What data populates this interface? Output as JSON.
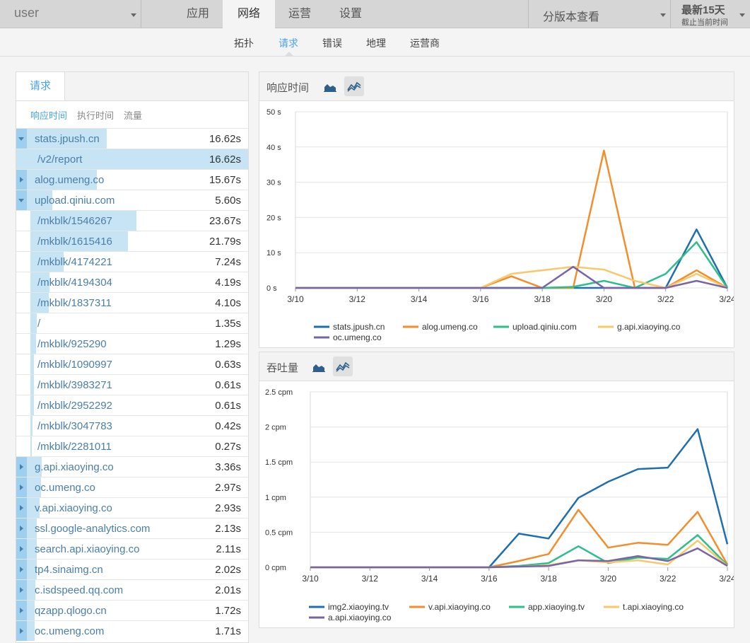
{
  "topnav": {
    "user": "user",
    "tabs": [
      "应用",
      "网络",
      "运营",
      "设置"
    ],
    "active_tab": 1,
    "version_select": "分版本查看",
    "range_title": "最新15天",
    "range_sub": "截止当前时间"
  },
  "subnav": {
    "tabs": [
      "拓扑",
      "请求",
      "错误",
      "地理",
      "运营商"
    ],
    "active": 1
  },
  "left": {
    "tab": "请求",
    "metrics": [
      "响应时间",
      "执行时间",
      "流量"
    ],
    "rows": [
      {
        "name": "stats.jpush.cn",
        "value": "16.62s",
        "kind": "down",
        "ratio": 0.75
      },
      {
        "name": "/v2/report",
        "value": "16.62s",
        "kind": "child",
        "ratio": 0.75,
        "selected": true
      },
      {
        "name": "alog.umeng.co",
        "value": "15.67s",
        "kind": "right",
        "ratio": 0.66
      },
      {
        "name": "upload.qiniu.com",
        "value": "5.60s",
        "kind": "down",
        "ratio": 0.24
      },
      {
        "name": "/mkblk/1546267",
        "value": "23.67s",
        "kind": "child",
        "ratio": 1.0
      },
      {
        "name": "/mkblk/1615416",
        "value": "21.79s",
        "kind": "child",
        "ratio": 0.92
      },
      {
        "name": "/mkblk/4174221",
        "value": "7.24s",
        "kind": "child",
        "ratio": 0.31
      },
      {
        "name": "/mkblk/4194304",
        "value": "4.19s",
        "kind": "child",
        "ratio": 0.18
      },
      {
        "name": "/mkblk/1837311",
        "value": "4.10s",
        "kind": "child",
        "ratio": 0.17
      },
      {
        "name": "/",
        "value": "1.35s",
        "kind": "child",
        "ratio": 0.06
      },
      {
        "name": "/mkblk/925290",
        "value": "1.29s",
        "kind": "child",
        "ratio": 0.05
      },
      {
        "name": "/mkblk/1090997",
        "value": "0.63s",
        "kind": "child",
        "ratio": 0.03
      },
      {
        "name": "/mkblk/3983271",
        "value": "0.61s",
        "kind": "child",
        "ratio": 0.03
      },
      {
        "name": "/mkblk/2952292",
        "value": "0.61s",
        "kind": "child",
        "ratio": 0.03
      },
      {
        "name": "/mkblk/3047783",
        "value": "0.42s",
        "kind": "child",
        "ratio": 0.02
      },
      {
        "name": "/mkblk/2281011",
        "value": "0.27s",
        "kind": "child",
        "ratio": 0.01
      },
      {
        "name": "g.api.xiaoying.co",
        "value": "3.36s",
        "kind": "right",
        "ratio": 0.14
      },
      {
        "name": "oc.umeng.co",
        "value": "2.97s",
        "kind": "right",
        "ratio": 0.13
      },
      {
        "name": "v.api.xiaoying.co",
        "value": "2.93s",
        "kind": "right",
        "ratio": 0.12
      },
      {
        "name": "ssl.google-analytics.com",
        "value": "2.13s",
        "kind": "right",
        "ratio": 0.09
      },
      {
        "name": "search.api.xiaoying.co",
        "value": "2.11s",
        "kind": "right",
        "ratio": 0.09
      },
      {
        "name": "tp4.sinaimg.cn",
        "value": "2.02s",
        "kind": "right",
        "ratio": 0.09
      },
      {
        "name": "c.isdspeed.qq.com",
        "value": "2.01s",
        "kind": "right",
        "ratio": 0.08
      },
      {
        "name": "qzapp.qlogo.cn",
        "value": "1.72s",
        "kind": "right",
        "ratio": 0.07
      },
      {
        "name": "oc.umeng.com",
        "value": "1.71s",
        "kind": "right",
        "ratio": 0.07
      }
    ]
  },
  "charts": {
    "response": {
      "title": "响应时间"
    },
    "throughput": {
      "title": "吞吐量"
    }
  },
  "chart_data": [
    {
      "type": "line",
      "title": "响应时间",
      "x": [
        "3/10",
        "3/11",
        "3/12",
        "3/13",
        "3/14",
        "3/15",
        "3/16",
        "3/17",
        "3/18",
        "3/19",
        "3/20",
        "3/21",
        "3/22",
        "3/23",
        "3/24"
      ],
      "x_ticks": [
        "3/10",
        "3/12",
        "3/14",
        "3/16",
        "3/18",
        "3/20",
        "3/22",
        "3/24"
      ],
      "y_ticks": [
        "0 s",
        "10 s",
        "20 s",
        "30 s",
        "40 s",
        "50 s"
      ],
      "ylim": [
        0,
        50
      ],
      "grid": true,
      "legend": "bottom",
      "series": [
        {
          "name": "stats.jpush.cn",
          "color": "#1f6fad",
          "values": [
            0,
            0,
            0,
            0,
            0,
            0,
            0,
            0,
            0,
            0,
            0,
            0,
            0,
            16.6,
            0
          ]
        },
        {
          "name": "alog.umeng.co",
          "color": "#f28e2b",
          "values": [
            0,
            0,
            0,
            0,
            0,
            0,
            0,
            3.3,
            0,
            0,
            39,
            0,
            0,
            5,
            0
          ]
        },
        {
          "name": "upload.qiniu.com",
          "color": "#2bbf8a",
          "values": [
            0,
            0,
            0,
            0,
            0,
            0,
            0,
            0,
            0,
            0.3,
            2,
            0,
            4,
            13,
            0
          ]
        },
        {
          "name": "g.api.xiaoying.co",
          "color": "#f7c96a",
          "values": [
            0,
            0,
            0,
            0,
            0,
            0,
            0,
            4,
            5,
            6,
            5.2,
            2,
            0,
            4,
            0
          ]
        },
        {
          "name": "oc.umeng.co",
          "color": "#7a64a8",
          "values": [
            0,
            0,
            0,
            0,
            0,
            0,
            0,
            0,
            0,
            6,
            0,
            0,
            0,
            2,
            0
          ]
        }
      ]
    },
    {
      "type": "line",
      "title": "吞吐量",
      "x": [
        "3/10",
        "3/11",
        "3/12",
        "3/13",
        "3/14",
        "3/15",
        "3/16",
        "3/17",
        "3/18",
        "3/19",
        "3/20",
        "3/21",
        "3/22",
        "3/23",
        "3/24"
      ],
      "x_ticks": [
        "3/10",
        "3/12",
        "3/14",
        "3/16",
        "3/18",
        "3/20",
        "3/22",
        "3/24"
      ],
      "y_ticks": [
        "0 cpm",
        "0.5 cpm",
        "1 cpm",
        "1.5 cpm",
        "2 cpm",
        "2.5 cpm"
      ],
      "ylim": [
        0,
        2.5
      ],
      "grid": true,
      "legend": "bottom",
      "series": [
        {
          "name": "img2.xiaoying.tv",
          "color": "#1f6fad",
          "values": [
            0,
            0,
            0,
            0,
            0,
            0,
            0,
            0.48,
            0.41,
            0.99,
            1.22,
            1.4,
            1.42,
            1.97,
            0.33
          ]
        },
        {
          "name": "v.api.xiaoying.co",
          "color": "#f28e2b",
          "values": [
            0,
            0,
            0,
            0,
            0,
            0,
            0,
            0.09,
            0.19,
            0.82,
            0.28,
            0.35,
            0.32,
            0.79,
            0.04
          ]
        },
        {
          "name": "app.xiaoying.tv",
          "color": "#2bbf8a",
          "values": [
            0,
            0,
            0,
            0,
            0,
            0,
            0,
            0.02,
            0.06,
            0.3,
            0.06,
            0.14,
            0.12,
            0.46,
            0.03
          ]
        },
        {
          "name": "t.api.xiaoying.co",
          "color": "#f7c96a",
          "values": [
            0,
            0,
            0,
            0,
            0,
            0,
            0,
            0.01,
            0.03,
            0.1,
            0.07,
            0.1,
            0.04,
            0.38,
            0.02
          ]
        },
        {
          "name": "a.api.xiaoying.co",
          "color": "#7a64a8",
          "values": [
            0,
            0,
            0,
            0,
            0,
            0,
            0,
            0.01,
            0.02,
            0.1,
            0.09,
            0.16,
            0.09,
            0.27,
            0.02
          ]
        }
      ]
    }
  ]
}
